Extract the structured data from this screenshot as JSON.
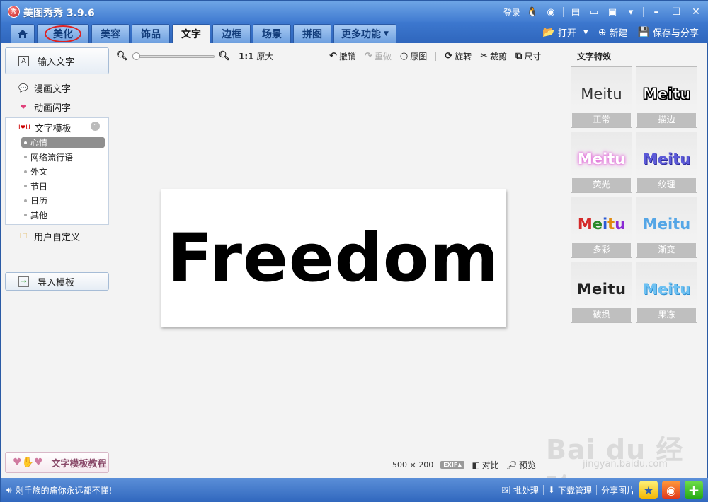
{
  "app": {
    "title": "美图秀秀 3.9.6",
    "logo_text": "秀"
  },
  "titlebar": {
    "login": "登录",
    "icons": [
      "qq-icon",
      "weibo-icon",
      "skin-icon",
      "feedback-icon",
      "message-icon",
      "settings-icon"
    ],
    "window_controls": [
      "minimize-icon",
      "maximize-icon",
      "close-icon"
    ]
  },
  "tabs": [
    {
      "label": "美化",
      "active": false,
      "circled": true
    },
    {
      "label": "美容",
      "active": false
    },
    {
      "label": "饰品",
      "active": false
    },
    {
      "label": "文字",
      "active": true
    },
    {
      "label": "边框",
      "active": false
    },
    {
      "label": "场景",
      "active": false
    },
    {
      "label": "拼图",
      "active": false
    },
    {
      "label": "更多功能",
      "active": false,
      "dropdown": true
    }
  ],
  "tab_actions": {
    "open": "打开",
    "new": "新建",
    "save_share": "保存与分享"
  },
  "left_panel": {
    "input_text": "输入文字",
    "comic_text": "漫画文字",
    "animated_text": "动画闪字",
    "templates_title": "文字模板",
    "template_items": [
      "心情",
      "网络流行语",
      "外文",
      "节日",
      "日历",
      "其他"
    ],
    "selected_template": "心情",
    "user_defined": "用户自定义",
    "import_template": "导入模板",
    "tutorial": "文字模板教程"
  },
  "editor": {
    "zoom_ratio": "1:1",
    "zoom_original": "原大",
    "zoom_level": 0.0,
    "undo": "撤销",
    "redo": "重做",
    "original": "原图",
    "rotate": "旋转",
    "crop": "裁剪",
    "size": "尺寸",
    "canvas_text": "Freedom",
    "image_width": "500",
    "times": "×",
    "image_height": "200",
    "exif": "EXIF▲",
    "compare": "对比",
    "preview": "预览"
  },
  "effects": {
    "title": "文字特效",
    "sample": "Meitu",
    "items": [
      {
        "label": "正常",
        "style": "normal"
      },
      {
        "label": "描边",
        "style": "stroke"
      },
      {
        "label": "荧光",
        "style": "glow"
      },
      {
        "label": "纹理",
        "style": "texture"
      },
      {
        "label": "多彩",
        "style": "multi"
      },
      {
        "label": "渐变",
        "style": "grad"
      },
      {
        "label": "破损",
        "style": "broken"
      },
      {
        "label": "果冻",
        "style": "jelly"
      }
    ]
  },
  "statusbar": {
    "message": "剁手族的痛你永远都不懂!",
    "batch": "批处理",
    "download_manager": "下载管理",
    "share_image": "分享图片"
  },
  "watermark": {
    "main": "Bai du 经验",
    "sub": "jingyan.baidu.com"
  },
  "colors": {
    "title_bar": "#3d78cf",
    "status_bar": "#2f66bd",
    "active_tab": "#f3f3f3",
    "circle_highlight": "#dd2222"
  }
}
